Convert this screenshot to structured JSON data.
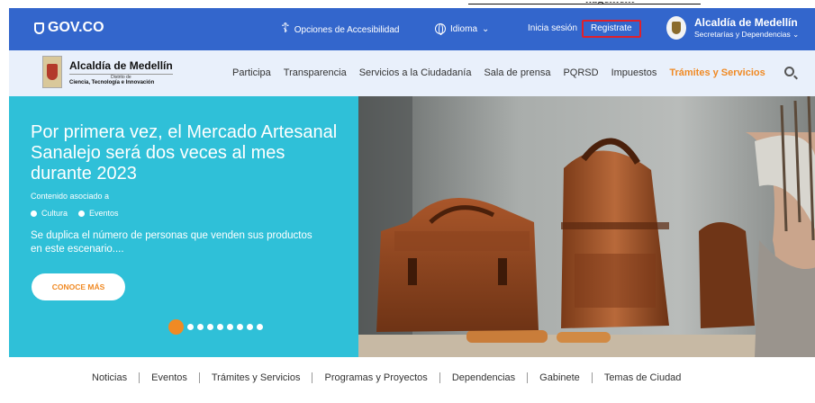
{
  "top_note": "nagement",
  "gov": {
    "logo": "GOV.CO",
    "accessibility": "Opciones de Accesibilidad",
    "language": "Idioma",
    "login": "Inicia sesión",
    "register": "Registrate",
    "entity_name": "Alcaldía de Medellín",
    "entity_sub": "Secretarías y Dependencias"
  },
  "brand": {
    "name": "Alcaldía de Medellín",
    "sub1": "Distrito de",
    "sub2": "Ciencia, Tecnología e Innovación"
  },
  "nav": {
    "items": [
      {
        "label": "Participa"
      },
      {
        "label": "Transparencia"
      },
      {
        "label": "Servicios a la Ciudadanía"
      },
      {
        "label": "Sala de prensa"
      },
      {
        "label": "PQRSD"
      },
      {
        "label": "Impuestos"
      },
      {
        "label": "Trámites y Servicios",
        "active": true
      }
    ]
  },
  "hero": {
    "title": "Por primera vez, el Mercado Artesanal Sanalejo será dos veces al mes durante 2023",
    "assoc_label": "Contenido asociado a",
    "tags": [
      "Cultura",
      "Eventos"
    ],
    "description": "Se duplica el número de personas que venden sus productos en este escenario....",
    "cta": "CONOCE MÁS",
    "slides_total": 9,
    "slide_active": 1
  },
  "bottom_links": [
    "Noticias",
    "Eventos",
    "Trámites y Servicios",
    "Programas y Proyectos",
    "Dependencias",
    "Gabinete",
    "Temas de Ciudad"
  ],
  "colors": {
    "gov_blue": "#3366cc",
    "accent_orange": "#f08a24",
    "hero_cyan": "#2fc0d8",
    "register_border": "#e0202a"
  }
}
